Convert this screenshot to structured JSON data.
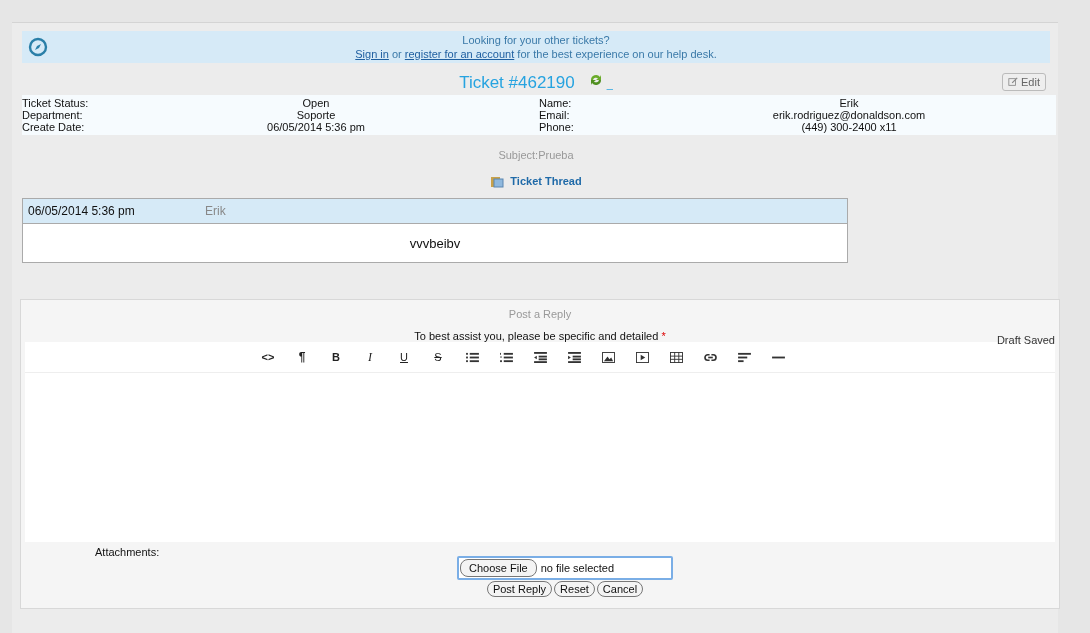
{
  "banner": {
    "line1": "Looking for your other tickets?",
    "sign_in": "Sign in",
    "or": "or",
    "register": "register for an account",
    "rest": "for the best experience on our help desk."
  },
  "ticket": {
    "title": "Ticket #462190",
    "underscore": "_",
    "edit": "Edit"
  },
  "info_left": [
    {
      "label": "Ticket Status:",
      "value": "Open"
    },
    {
      "label": "Department:",
      "value": "Soporte"
    },
    {
      "label": "Create Date:",
      "value": "06/05/2014 5:36 pm"
    }
  ],
  "info_right": [
    {
      "label": "Name:",
      "value": "Erik"
    },
    {
      "label": "Email:",
      "value": "erik.rodriguez@donaldson.com"
    },
    {
      "label": "Phone:",
      "value": "(449) 300-2400 x11"
    }
  ],
  "subject": "Subject:Prueba",
  "thread_title": "Ticket Thread",
  "thread": [
    {
      "date": "06/05/2014 5:36 pm",
      "author": "Erik",
      "body": "vvvbeibv"
    }
  ],
  "reply": {
    "heading": "Post a Reply",
    "prompt": "To best assist you, please be specific and detailed",
    "required": "*",
    "draft": "Draft Saved",
    "toolbar_glyphs": [
      "<>",
      "¶",
      "B",
      "I",
      "U",
      "S"
    ],
    "attachments_label": "Attachments:",
    "choose_file": "Choose File",
    "no_file": "no file selected",
    "buttons": [
      "Post Reply",
      "Reset",
      "Cancel"
    ]
  }
}
